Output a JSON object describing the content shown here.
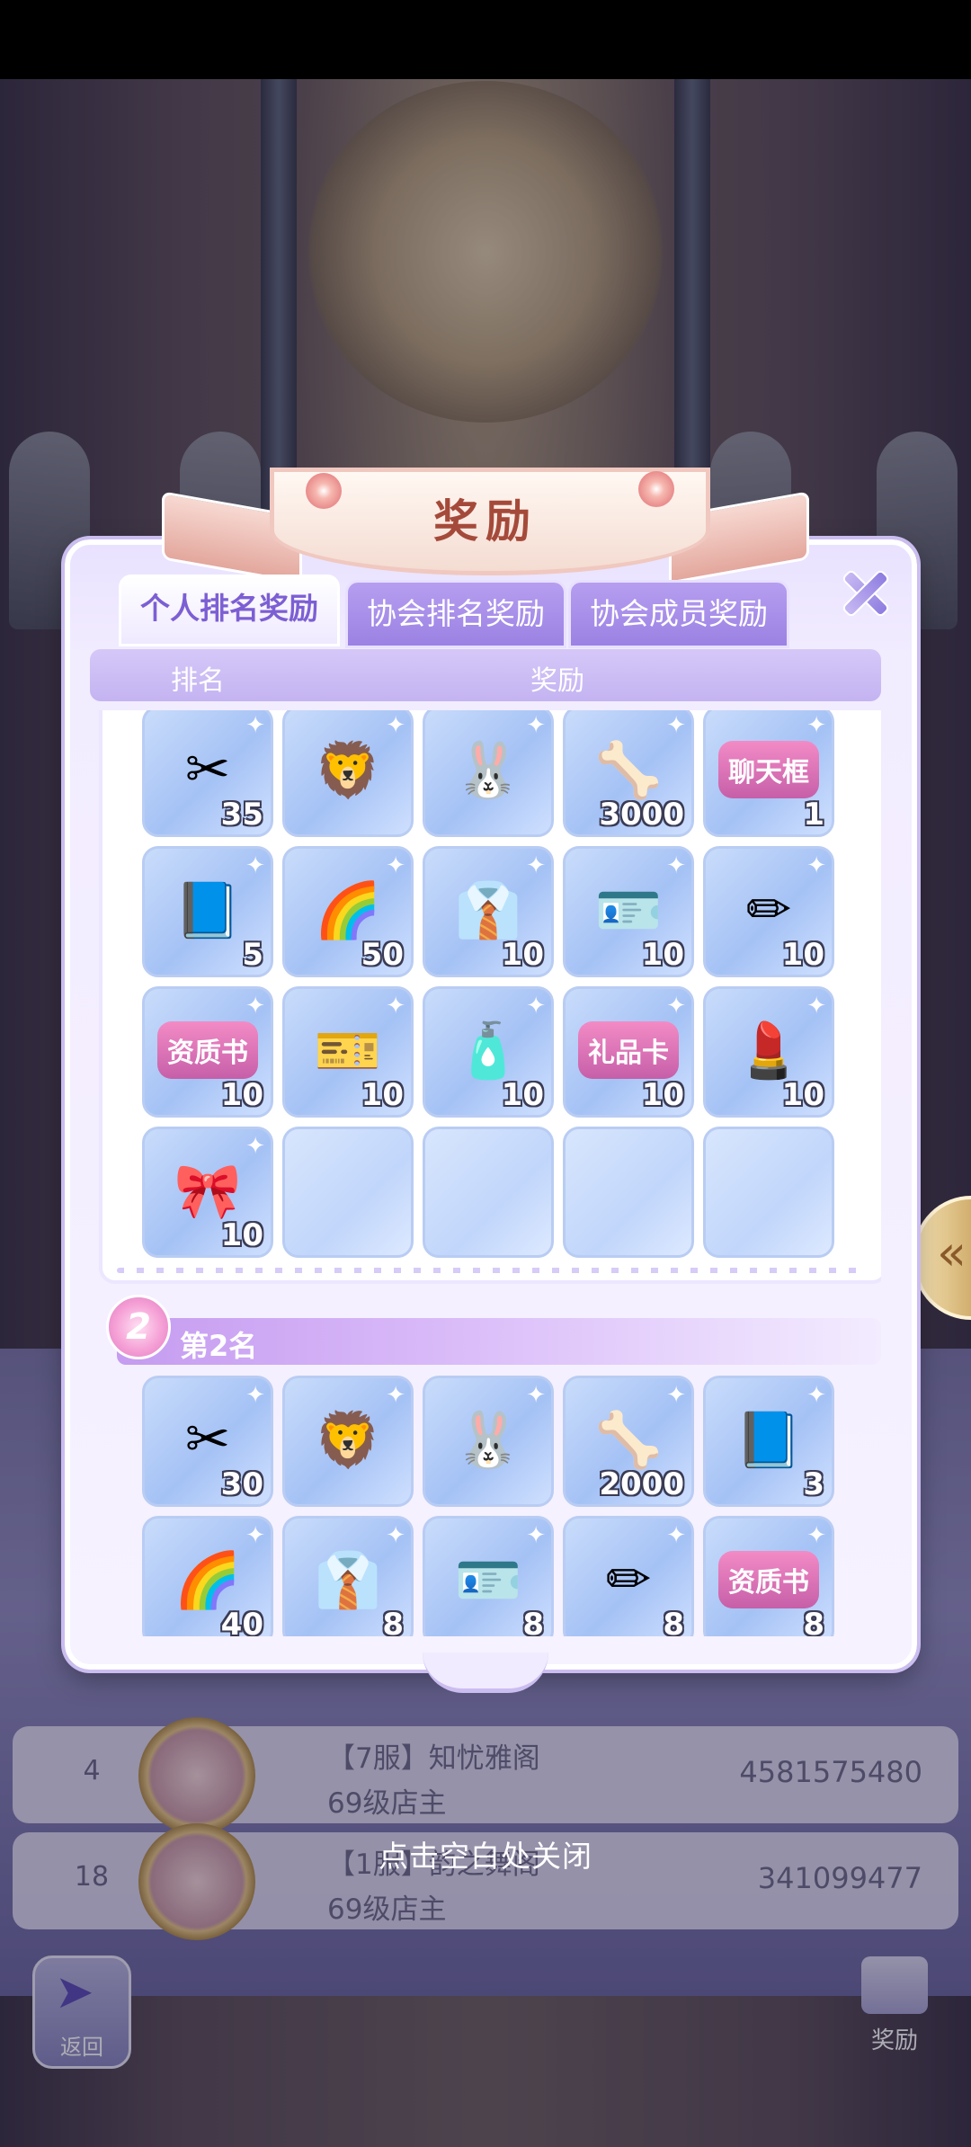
{
  "dialog": {
    "title": "奖励",
    "tabs": [
      {
        "label": "个人排名奖励",
        "active": true
      },
      {
        "label": "协会排名奖励",
        "active": false
      },
      {
        "label": "协会成员奖励",
        "active": false
      }
    ],
    "table_headers": {
      "rank": "排名",
      "reward": "奖励"
    },
    "rank1_rewards": [
      {
        "icon": "scissors-icon",
        "glyph": "✂",
        "qty": "35"
      },
      {
        "icon": "lion-icon",
        "glyph": "🦁",
        "qty": ""
      },
      {
        "icon": "bunny-icon",
        "glyph": "🐰",
        "qty": ""
      },
      {
        "icon": "bone-biscuit-icon",
        "glyph": "🦴",
        "qty": "3000"
      },
      {
        "icon": "chat-bubble-icon",
        "glyph": "聊天框",
        "qty": "1"
      },
      {
        "icon": "finance-book-icon",
        "glyph": "📘",
        "qty": "5"
      },
      {
        "icon": "rainbow-notebook-icon",
        "glyph": "🌈",
        "qty": "50"
      },
      {
        "icon": "suit-icon",
        "glyph": "👔",
        "qty": "10"
      },
      {
        "icon": "id-card-icon",
        "glyph": "🪪",
        "qty": "10"
      },
      {
        "icon": "blue-book-icon",
        "glyph": "✏",
        "qty": "10"
      },
      {
        "icon": "qualification-book-icon",
        "glyph": "资质书",
        "qty": "10"
      },
      {
        "icon": "check-ticket-icon",
        "glyph": "🎫",
        "qty": "10"
      },
      {
        "icon": "cream-tube-icon",
        "glyph": "🧴",
        "qty": "10"
      },
      {
        "icon": "gift-card-icon",
        "glyph": "礼品卡",
        "qty": "10"
      },
      {
        "icon": "lipstick-icon",
        "glyph": "💄",
        "qty": "10"
      },
      {
        "icon": "pink-bow-icon",
        "glyph": "🎀",
        "qty": "10"
      }
    ],
    "rank2": {
      "medal": "2",
      "label": "第2名",
      "rewards": [
        {
          "icon": "scissors-icon",
          "glyph": "✂",
          "qty": "30"
        },
        {
          "icon": "lion-icon",
          "glyph": "🦁",
          "qty": ""
        },
        {
          "icon": "bunny-icon",
          "glyph": "🐰",
          "qty": ""
        },
        {
          "icon": "bone-biscuit-icon",
          "glyph": "🦴",
          "qty": "2000"
        },
        {
          "icon": "finance-book-icon",
          "glyph": "📘",
          "qty": "3"
        },
        {
          "icon": "rainbow-notebook-icon",
          "glyph": "🌈",
          "qty": "40"
        },
        {
          "icon": "suit-icon",
          "glyph": "👔",
          "qty": "8"
        },
        {
          "icon": "id-card-icon",
          "glyph": "🪪",
          "qty": "8"
        },
        {
          "icon": "blue-book-icon",
          "glyph": "✏",
          "qty": "8"
        },
        {
          "icon": "qualification-book-icon",
          "glyph": "资质书",
          "qty": "8"
        }
      ]
    }
  },
  "background_list": [
    {
      "rank": "4",
      "name": "【7服】知忧雅阁",
      "level": "69级店主",
      "score": "4581575480"
    },
    {
      "rank": "18",
      "name": "【1服】韵之舞阁",
      "level": "69级店主",
      "score": "341099477"
    }
  ],
  "close_hint": "点击空白处关闭",
  "bottom_nav": {
    "back": "返回",
    "reward": "奖励"
  },
  "side_tab_glyph": "«"
}
